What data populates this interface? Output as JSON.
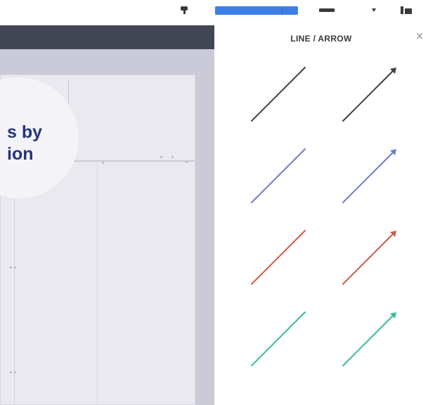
{
  "toolbar": {
    "icons": [
      "comment-icon",
      "primary-action-button",
      "layers-icon",
      "chevron-down-icon",
      "stats-icon"
    ],
    "primary_color": "#3d7de6"
  },
  "editor": {
    "headline_line1": "s by",
    "headline_line2": "ion",
    "headline_color": "#25357e",
    "header_color": "#424654",
    "background_color": "#cbcad8"
  },
  "panel": {
    "title": "LINE / ARROW",
    "close_label": "×",
    "items": [
      {
        "kind": "line",
        "color": "#404040"
      },
      {
        "kind": "arrow",
        "color": "#404040"
      },
      {
        "kind": "line",
        "color": "#6b7fc6"
      },
      {
        "kind": "arrow",
        "color": "#6b7fc6"
      },
      {
        "kind": "line",
        "color": "#cf5a48"
      },
      {
        "kind": "arrow",
        "color": "#cf5a48"
      },
      {
        "kind": "line",
        "color": "#35be94"
      },
      {
        "kind": "arrow",
        "color": "#35be94"
      }
    ]
  }
}
